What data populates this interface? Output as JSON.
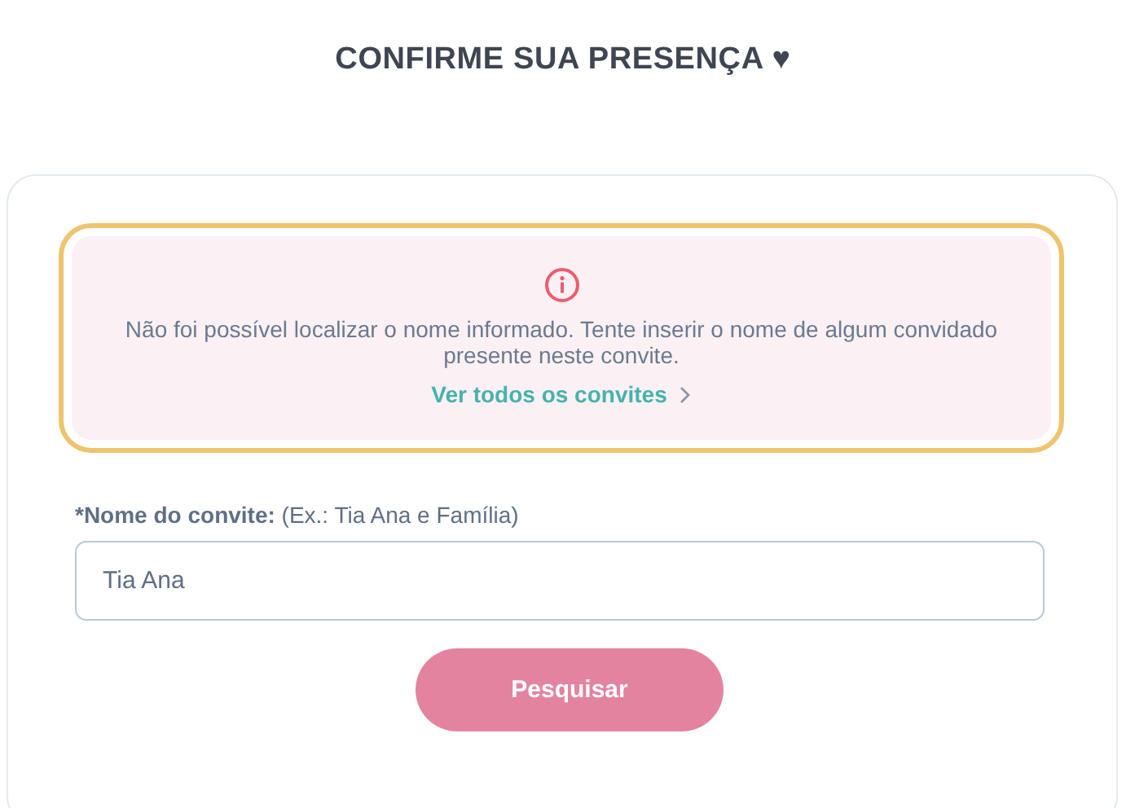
{
  "title": "CONFIRME SUA PRESENÇA ♥",
  "alert": {
    "message": "Não foi possível localizar o nome informado. Tente inserir o nome de algum convidado presente neste convite.",
    "link": "Ver todos os convites"
  },
  "field": {
    "label": "*Nome do convite:",
    "hint": "(Ex.: Tia Ana e Família)",
    "value": "Tia Ana"
  },
  "button": "Pesquisar"
}
